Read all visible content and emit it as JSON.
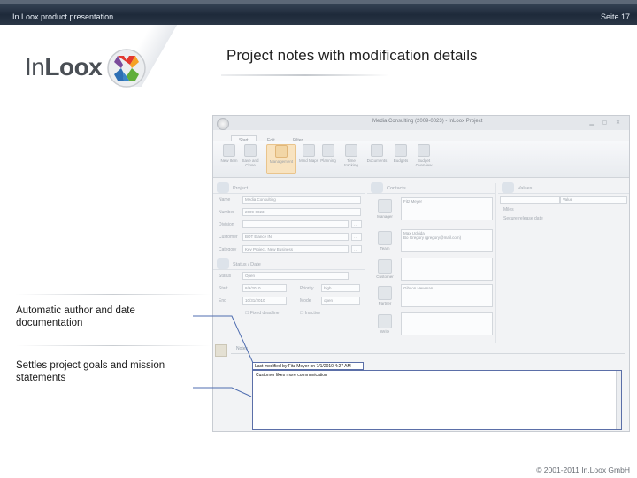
{
  "header": {
    "presentation_title": "In.Loox product presentation",
    "page_label": "Seite 17"
  },
  "logo": {
    "text_in": "In",
    "text_loox": "Loox"
  },
  "slide": {
    "title": "Project notes with modification details"
  },
  "callouts": [
    {
      "text": "Automatic author and date documentation"
    },
    {
      "text": "Settles project goals and mission statements"
    }
  ],
  "screenshot": {
    "window_title": "Media Consulting (2009-0023) - InLoox Project",
    "tabs": [
      {
        "label": "Start"
      },
      {
        "label": "Edit"
      },
      {
        "label": "Filter"
      }
    ],
    "ribbon": [
      {
        "label": "New Item"
      },
      {
        "label": "Save and Close"
      },
      {
        "label": "Management"
      },
      {
        "label": "Mind Maps"
      },
      {
        "label": "Planning"
      },
      {
        "label": "Time tracking"
      },
      {
        "label": "Documents"
      },
      {
        "label": "Budgets"
      },
      {
        "label": "Budget Overview"
      }
    ],
    "project": {
      "heading": "Project",
      "fields": [
        {
          "label": "Name",
          "value": "Media Consulting"
        },
        {
          "label": "Number",
          "value": "2009-0023"
        },
        {
          "label": "Division",
          "value": ""
        },
        {
          "label": "Customer",
          "value": "BOT Elance IN"
        },
        {
          "label": "Category",
          "value": "Key Project, New Business"
        }
      ]
    },
    "status": {
      "heading": "Status / Date",
      "fields": [
        {
          "label": "Status",
          "value": "Open"
        },
        {
          "label": "Start",
          "value": "8/9/2010"
        },
        {
          "label": "End",
          "value": "10/31/2010"
        }
      ],
      "priority_label": "Priority",
      "priority_value": "high",
      "mode_label": "Mode",
      "mode_value": "open",
      "checkbox_fixed": "Fixed deadline",
      "checkbox_inactive": "Inactive"
    },
    "contacts": {
      "heading": "Contacts",
      "roles": [
        {
          "label": "Manager",
          "value": "Fitz Meyer"
        },
        {
          "label": "Team",
          "value": "Max Uchida\nBo Gregory (gregory@mail.com)"
        },
        {
          "label": "Customer",
          "value": ""
        },
        {
          "label": "Partner",
          "value": "Gibson Newman"
        },
        {
          "label": "Write",
          "value": ""
        }
      ]
    },
    "values": {
      "heading": "Values",
      "col_value": "Value",
      "col_empty": "",
      "rows": [
        {
          "label": "Miles"
        },
        {
          "label": "Secure release date"
        }
      ]
    },
    "notes": {
      "heading": "Notes",
      "last_modified": "Last modified by Fitz Meyer on 7/1/2010 4:27 AM",
      "content": "Customer likes more communication"
    }
  },
  "footer": {
    "copyright": "© 2001-2011 In.Loox GmbH"
  },
  "colors": {
    "header_bg": "#1e2a3a",
    "note_border": "#5b6fa8",
    "callout_line": "#4f6db0"
  }
}
